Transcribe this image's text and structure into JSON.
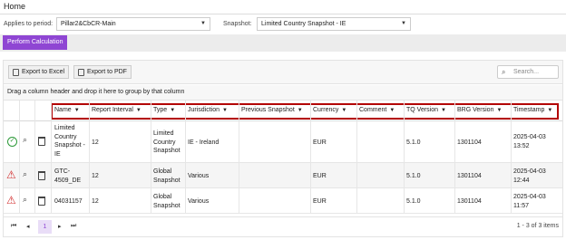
{
  "page": {
    "title": "Home"
  },
  "filters": {
    "period_label": "Applies to period:",
    "period_value": "Pillar2&CbCR-Main",
    "snapshot_label": "Snapshot:",
    "snapshot_value": "Limited Country Snapshot - IE"
  },
  "actions": {
    "perform_label": "Perform Calculation"
  },
  "toolbar": {
    "excel_label": "Export to Excel",
    "pdf_label": "Export to PDF",
    "search_placeholder": "Search..."
  },
  "grid": {
    "group_hint": "Drag a column header and drop it here to group by that column",
    "columns": [
      "Name",
      "Report Interval",
      "Type",
      "Jurisdiction",
      "Previous Snapshot",
      "Currency",
      "Comment",
      "TQ Version",
      "BRG Version",
      "Timestamp"
    ],
    "rows": [
      {
        "status": "success",
        "name": "Limited Country Snapshot - IE",
        "interval": "12",
        "type": "Limited Country Snapshot",
        "jurisdiction": "IE - Ireland",
        "previous": "",
        "currency": "EUR",
        "comment": "",
        "tq": "5.1.0",
        "brg": "1301104",
        "timestamp": "2025-04-03 13:52"
      },
      {
        "status": "warning",
        "name": "GTC-4509_DE",
        "interval": "12",
        "type": "Global Snapshot",
        "jurisdiction": "Various",
        "previous": "",
        "currency": "EUR",
        "comment": "",
        "tq": "5.1.0",
        "brg": "1301104",
        "timestamp": "2025-04-03 12:44"
      },
      {
        "status": "warning",
        "name": "04031157",
        "interval": "12",
        "type": "Global Snapshot",
        "jurisdiction": "Various",
        "previous": "",
        "currency": "EUR",
        "comment": "",
        "tq": "5.1.0",
        "brg": "1301104",
        "timestamp": "2025-04-03 11:57"
      }
    ]
  },
  "pager": {
    "first": "⏮",
    "prev": "◂",
    "page": "1",
    "next": "▸",
    "last": "⏭",
    "info": "1 - 3 of 3 items"
  },
  "colors": {
    "accent": "#8f46d3",
    "highlight_box": "#b30000",
    "success": "#2e9a3a",
    "warning": "#d32f2f"
  }
}
